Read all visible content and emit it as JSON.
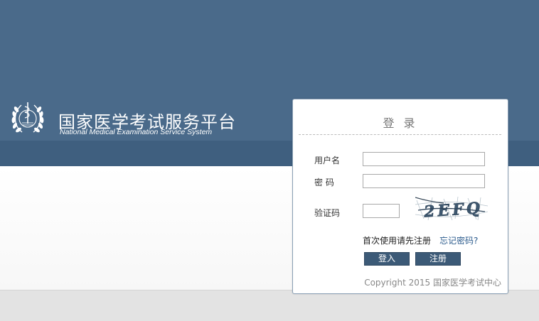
{
  "brand": {
    "title": "国家医学考试服务平台",
    "subtitle": "National Medical Examination Service System",
    "emblem_icon": "medical-emblem-icon"
  },
  "login": {
    "title": "登 录",
    "username_label": "用户名",
    "username_value": "",
    "password_label": "密 码",
    "password_value": "",
    "captcha_label": "验证码",
    "captcha_value": "",
    "captcha_text": "2EFQ",
    "first_time_text": "首次使用请先注册",
    "forgot_link": "忘记密码?",
    "login_button": "登入",
    "register_button": "注册",
    "copyright": "Copyright 2015 国家医学考试中心"
  },
  "colors": {
    "header": "#4a6a8a",
    "band": "#3f5f7f",
    "button": "#3c5a77",
    "link": "#2a5a8c",
    "panel_border": "#8aa0b5"
  }
}
